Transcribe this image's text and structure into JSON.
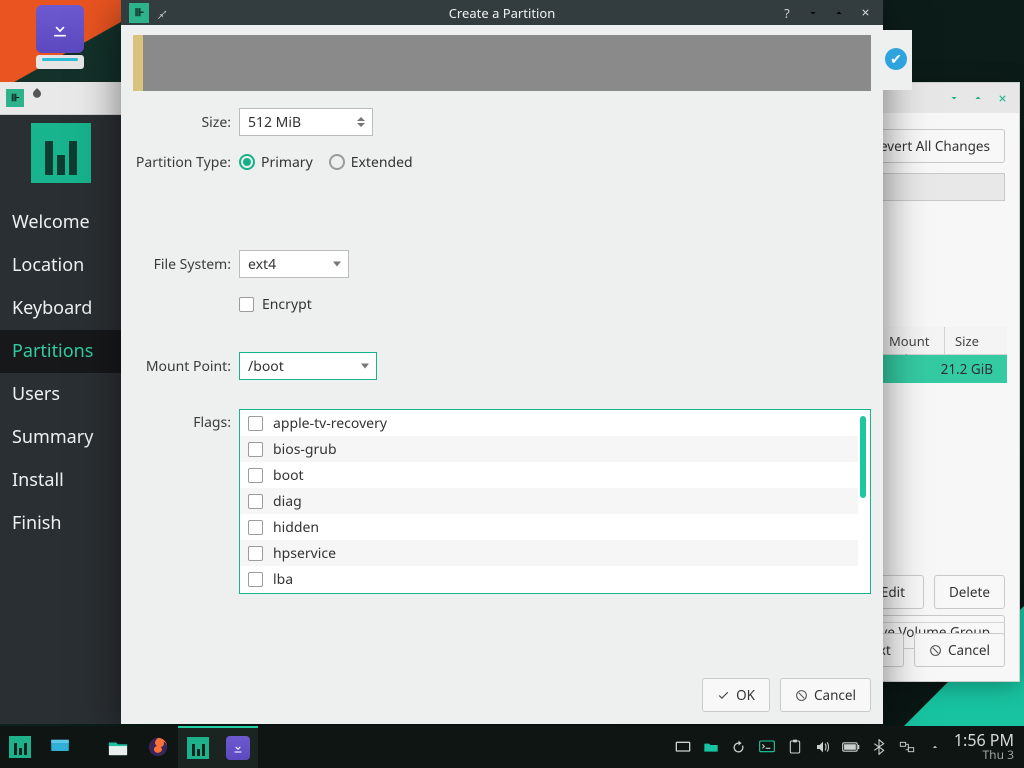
{
  "dialog": {
    "title": "Create a Partition",
    "size_label": "Size:",
    "size_value": "512 MiB",
    "ptype_label": "Partition Type:",
    "ptype_primary": "Primary",
    "ptype_extended": "Extended",
    "fs_label": "File System:",
    "fs_value": "ext4",
    "encrypt_label": "Encrypt",
    "mount_label": "Mount Point:",
    "mount_value": "/boot",
    "flags_label": "Flags:",
    "flags": [
      "apple-tv-recovery",
      "bios-grub",
      "boot",
      "diag",
      "hidden",
      "hpservice",
      "lba"
    ],
    "ok": "OK",
    "cancel": "Cancel"
  },
  "installer": {
    "steps": [
      "Welcome",
      "Location",
      "Keyboard",
      "Partitions",
      "Users",
      "Summary",
      "Install",
      "Finish"
    ],
    "active_step": 3,
    "revert": "Revert All Changes",
    "table": {
      "h_mount": "Mount Point",
      "h_size": "Size",
      "row_size": "21.2 GiB"
    },
    "edit": "Edit",
    "delete": "Delete",
    "vg": "Remove Volume Group",
    "next": "Next",
    "cancel": "Cancel"
  },
  "taskbar": {
    "time": "1:56 PM",
    "date": "Thu 3"
  }
}
